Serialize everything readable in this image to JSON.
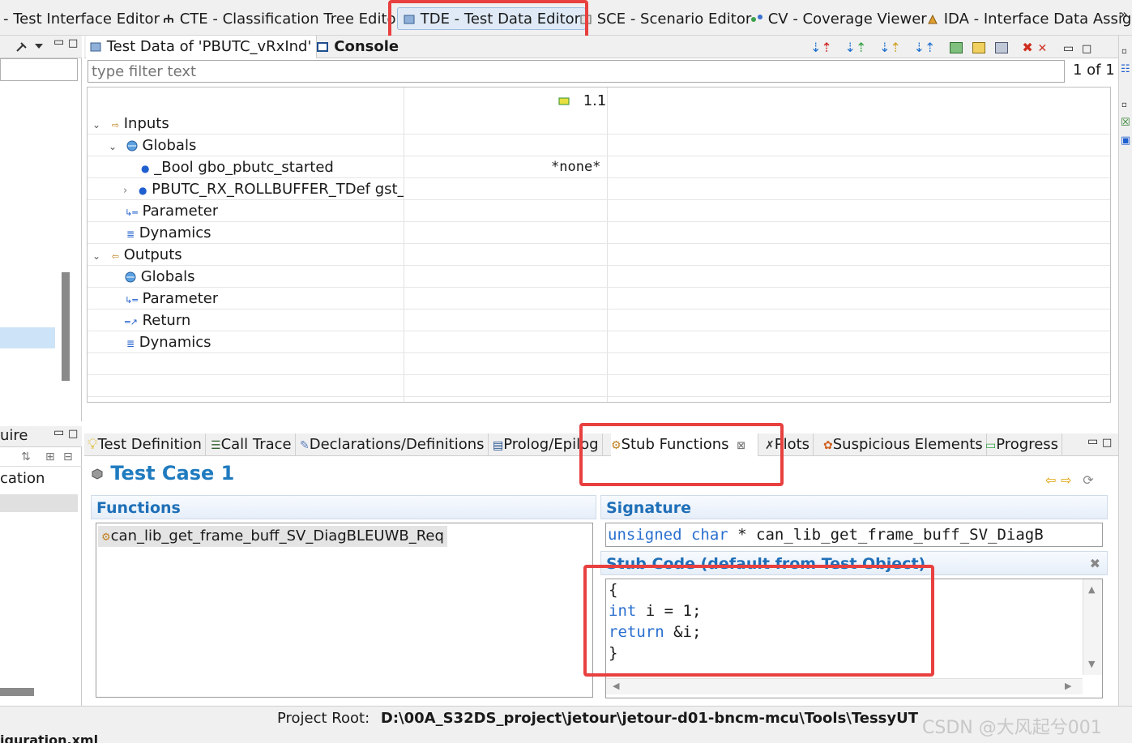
{
  "perspective_tabs": [
    {
      "label": "- Test Interface Editor"
    },
    {
      "label": "CTE - Classification Tree Editor"
    },
    {
      "label": "TDE - Test Data Editor"
    },
    {
      "label": "SCE - Scenario Editor"
    },
    {
      "label": "CV - Coverage Viewer"
    },
    {
      "label": "IDA - Interface Data Assig"
    }
  ],
  "editor": {
    "tab_label": "Test Data of 'PBUTC_vRxInd'",
    "console_label": "Console",
    "filter_placeholder": "type filter text",
    "page_count": "1 of 1",
    "column_header": "1.1",
    "rows": [
      {
        "label": "Inputs",
        "value": ""
      },
      {
        "label": "Globals",
        "value": ""
      },
      {
        "label": "_Bool gbo_pbutc_started",
        "value": "*none*"
      },
      {
        "label": "PBUTC_RX_ROLLBUFFER_TDef gst_p",
        "value": ""
      },
      {
        "label": "Parameter",
        "value": ""
      },
      {
        "label": "Dynamics",
        "value": ""
      },
      {
        "label": "Outputs",
        "value": ""
      },
      {
        "label": "Globals",
        "value": ""
      },
      {
        "label": "Parameter",
        "value": ""
      },
      {
        "label": "Return",
        "value": ""
      },
      {
        "label": "Dynamics",
        "value": ""
      }
    ]
  },
  "left_panel": {
    "bottom_tab_fragment": "uire",
    "bottom_item_fragment": "cation"
  },
  "views": {
    "tabs": [
      {
        "label": "Test Definition"
      },
      {
        "label": "Call Trace"
      },
      {
        "label": "Declarations/Definitions"
      },
      {
        "label": "Prolog/Epilog"
      },
      {
        "label": "Stub Functions"
      },
      {
        "label": "Plots"
      },
      {
        "label": "Suspicious Elements"
      },
      {
        "label": "Progress"
      }
    ],
    "close_glyph": "⊠"
  },
  "test_case": {
    "title": "Test Case 1",
    "functions_header": "Functions",
    "function_item": "can_lib_get_frame_buff_SV_DiagBLEUWB_Req",
    "signature_header": "Signature",
    "signature_kw1": "unsigned",
    "signature_kw2": "char",
    "signature_rest": " * can_lib_get_frame_buff_SV_DiagB",
    "stub_header": "Stub Code (default from Test Object)",
    "code": {
      "line1": "{",
      "line2_kw": "int",
      "line2_rest": " i = 1;",
      "line3_kw": "return",
      "line3_rest": " &i;",
      "line4": "}"
    }
  },
  "status_bar": {
    "project_root_label": "Project Root:",
    "project_root_value": "D:\\00A_S32DS_project\\jetour\\jetour-d01-bncm-mcu\\Tools\\TessyUT",
    "bottom_fragment": "iguration.xml"
  },
  "watermark": "CSDN @大风起兮001",
  "colors": {
    "highlight_box": "#e8403f",
    "accent_blue": "#1f7bbf",
    "keyword_blue": "#2a6fcf"
  }
}
